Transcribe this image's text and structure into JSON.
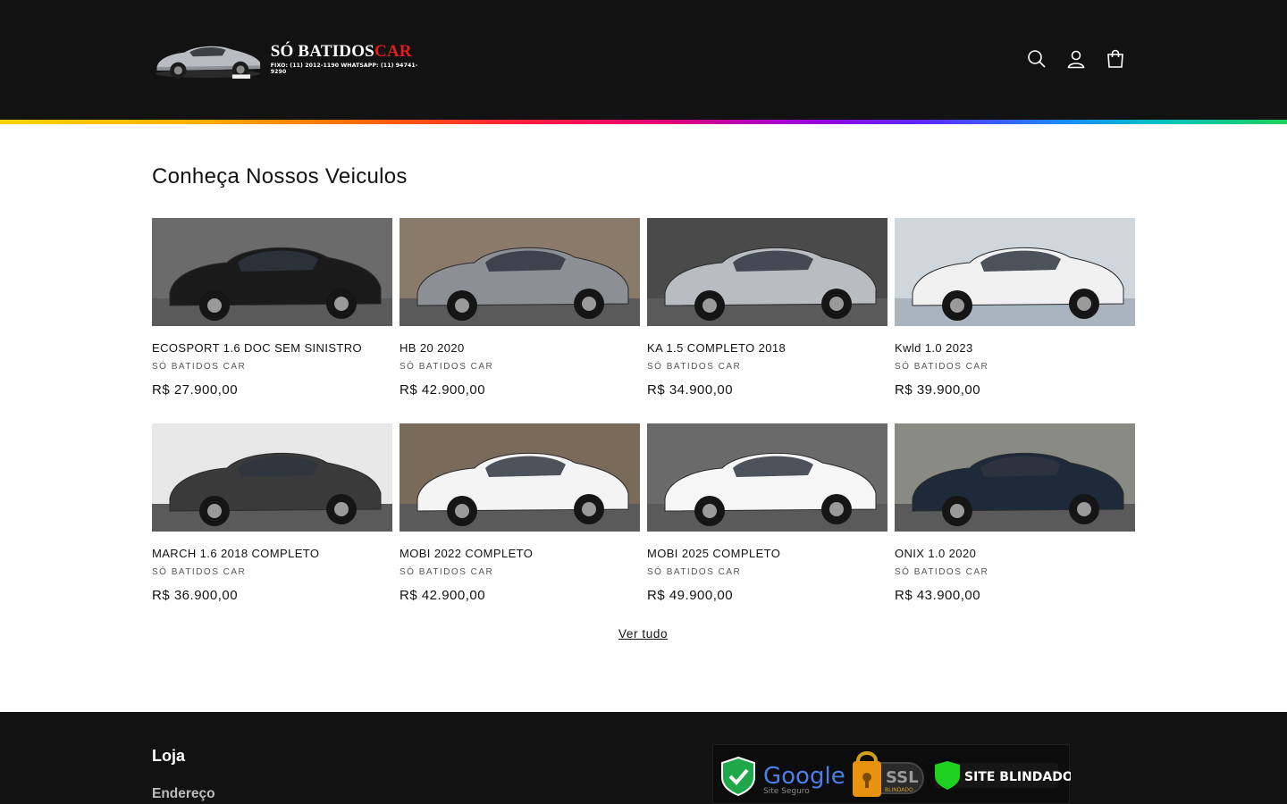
{
  "header": {
    "logo": {
      "name_main": "SÓ BATIDOS",
      "name_accent": "CAR",
      "contact": "FIXO: (11) 2012-1190   WHATSAPP: (11) 94741-9290"
    },
    "icons": [
      "search-icon",
      "account-icon",
      "cart-icon"
    ]
  },
  "colors": {
    "header_bg": "#121212",
    "accent_red": "#e21b1b",
    "rainbow": [
      "#f5d300",
      "#ff6a00",
      "#ff1f3a",
      "#e0007a",
      "#a100d8",
      "#5a2bff",
      "#1f86ff",
      "#00c2c2",
      "#1fd15a"
    ]
  },
  "section": {
    "title": "Conheça Nossos Veiculos",
    "view_all": "Ver tudo"
  },
  "products": [
    {
      "title": "ECOSPORT 1.6 DOC SEM SINISTRO",
      "vendor": "SÓ BATIDOS CAR",
      "price": "R$ 27.900,00",
      "car_color": "#1a1a1a"
    },
    {
      "title": "HB 20 2020",
      "vendor": "SÓ BATIDOS CAR",
      "price": "R$ 42.900,00",
      "car_color": "#8c8f94"
    },
    {
      "title": "KA 1.5 COMPLETO  2018",
      "vendor": "SÓ BATIDOS CAR",
      "price": "R$ 34.900,00",
      "car_color": "#b9bcc0"
    },
    {
      "title": "Kwld 1.0 2023",
      "vendor": "SÓ BATIDOS CAR",
      "price": "R$ 39.900,00",
      "car_color": "#f1f1f1"
    },
    {
      "title": "MARCH 1.6 2018 COMPLETO",
      "vendor": "SÓ BATIDOS CAR",
      "price": "R$ 36.900,00",
      "car_color": "#3a3a3a"
    },
    {
      "title": "MOBI 2022 COMPLETO",
      "vendor": "SÓ BATIDOS CAR",
      "price": "R$ 42.900,00",
      "car_color": "#f4f4f4"
    },
    {
      "title": "MOBI 2025 COMPLETO",
      "vendor": "SÓ BATIDOS CAR",
      "price": "R$ 49.900,00",
      "car_color": "#f6f6f6"
    },
    {
      "title": "ONIX 1.0 2020",
      "vendor": "SÓ BATIDOS CAR",
      "price": "R$ 43.900,00",
      "car_color": "#1e2a3a"
    }
  ],
  "footer": {
    "heading": "Loja",
    "link": "Endereço",
    "seals": {
      "google_label": "Google",
      "google_sub": "Site Seguro",
      "ssl_label": "SSL",
      "ssl_sub": "BLINDADO",
      "blindado_label": "SITE BLINDADO"
    }
  }
}
